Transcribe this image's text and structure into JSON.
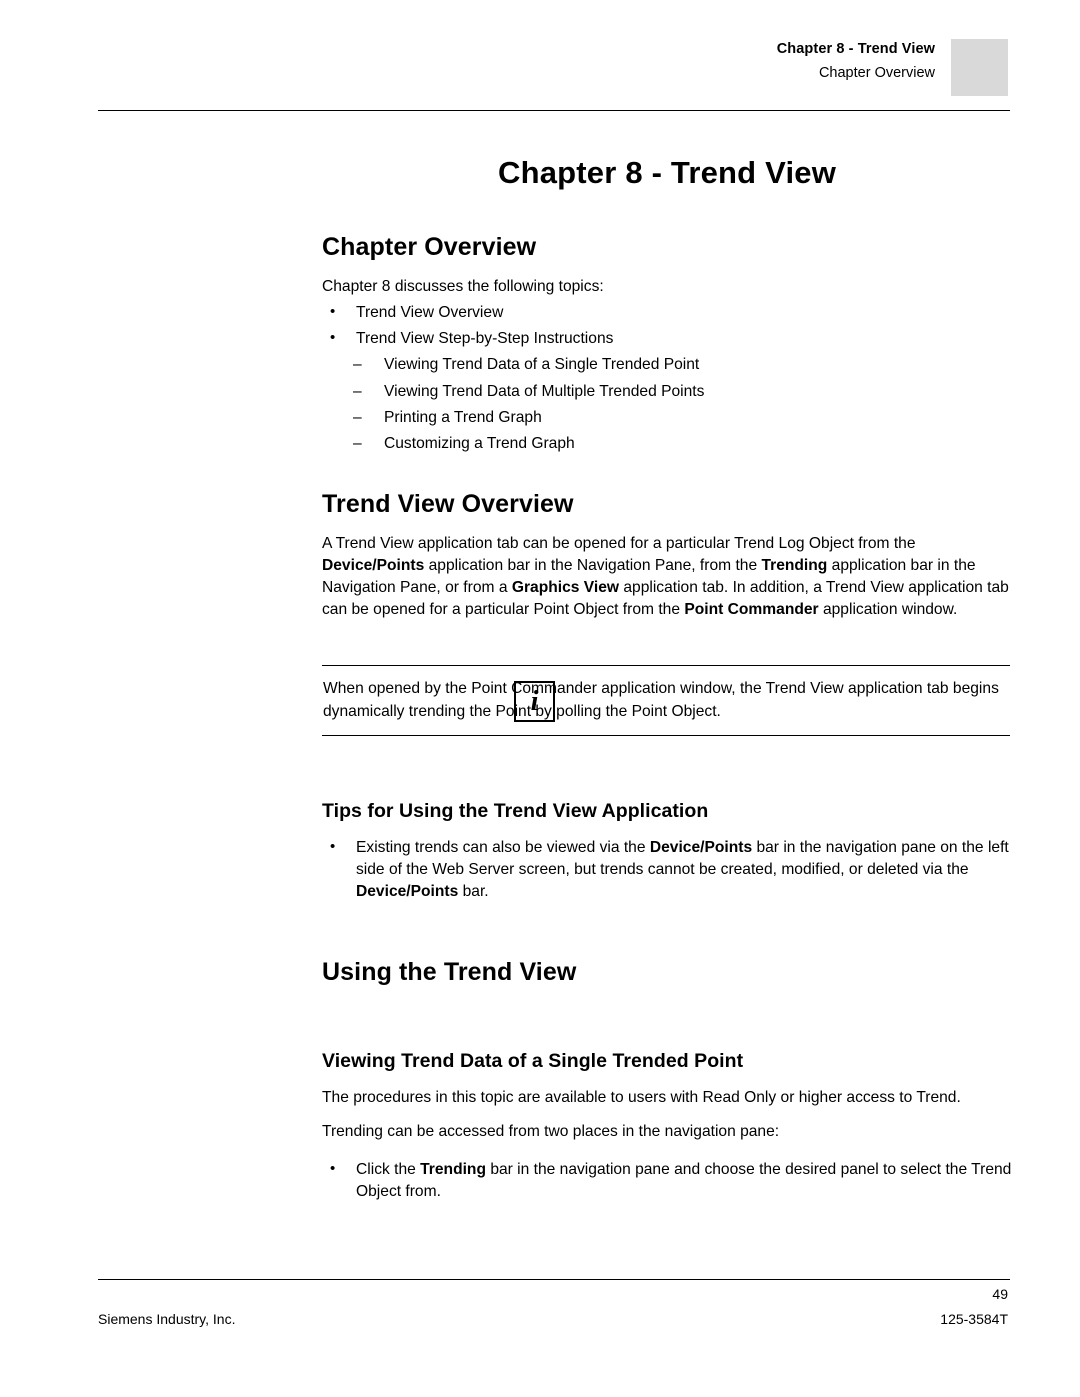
{
  "header": {
    "line1": "Chapter 8 - Trend View",
    "line2": "Chapter Overview"
  },
  "chapter_title": "Chapter 8 - Trend View",
  "sections": {
    "chapter_overview": {
      "heading": "Chapter Overview",
      "intro": "Chapter 8 discusses the following topics:",
      "bullets": [
        "Trend View Overview",
        "Trend View Step-by-Step Instructions"
      ],
      "dashes": [
        "Viewing Trend Data of a Single Trended Point",
        "Viewing Trend Data of Multiple Trended Points",
        "Printing a Trend Graph",
        "Customizing a Trend Graph"
      ]
    },
    "trend_view_overview": {
      "heading": "Trend View Overview",
      "paragraph_parts": [
        {
          "text": "A Trend View application tab can be opened for a particular Trend Log Object from the ",
          "bold": false
        },
        {
          "text": "Device/Points",
          "bold": true
        },
        {
          "text": " application bar in the Navigation Pane, from the ",
          "bold": false
        },
        {
          "text": "Trending",
          "bold": true
        },
        {
          "text": " application bar in the Navigation Pane, or from a ",
          "bold": false
        },
        {
          "text": "Graphics View",
          "bold": true
        },
        {
          "text": " application tab. In addition, a Trend View application tab can be opened for a particular Point Object from the ",
          "bold": false
        },
        {
          "text": "Point Commander",
          "bold": true
        },
        {
          "text": " application window.",
          "bold": false
        }
      ]
    },
    "note": {
      "icon": "info-icon",
      "icon_glyph": "i",
      "text": "When opened by the Point Commander application window, the Trend View application tab begins dynamically trending the Point by polling the Point Object."
    },
    "tips": {
      "heading": "Tips for Using the Trend View Application",
      "bullet_parts": [
        {
          "text": "Existing trends can also be viewed via the ",
          "bold": false
        },
        {
          "text": "Device/Points",
          "bold": true
        },
        {
          "text": " bar in the navigation pane on the left side of the Web Server screen, but trends cannot be created, modified, or deleted via the ",
          "bold": false
        },
        {
          "text": "Device/Points",
          "bold": true
        },
        {
          "text": " bar.",
          "bold": false
        }
      ]
    },
    "using_the_trend_view": {
      "heading": "Using the Trend View"
    },
    "viewing_single_point": {
      "heading": "Viewing Trend Data of a Single Trended Point",
      "paragraph1": "The procedures in this topic are available to users with Read Only or higher access to Trend.",
      "paragraph2": "Trending can be accessed from two places in the navigation pane:",
      "bullet_parts": [
        {
          "text": "Click the ",
          "bold": false
        },
        {
          "text": "Trending",
          "bold": true
        },
        {
          "text": " bar in the navigation pane and choose the desired panel to select the Trend Object from.",
          "bold": false
        }
      ]
    }
  },
  "footer": {
    "page_number": "49",
    "left": "Siemens Industry, Inc.",
    "right": "125-3584T"
  }
}
